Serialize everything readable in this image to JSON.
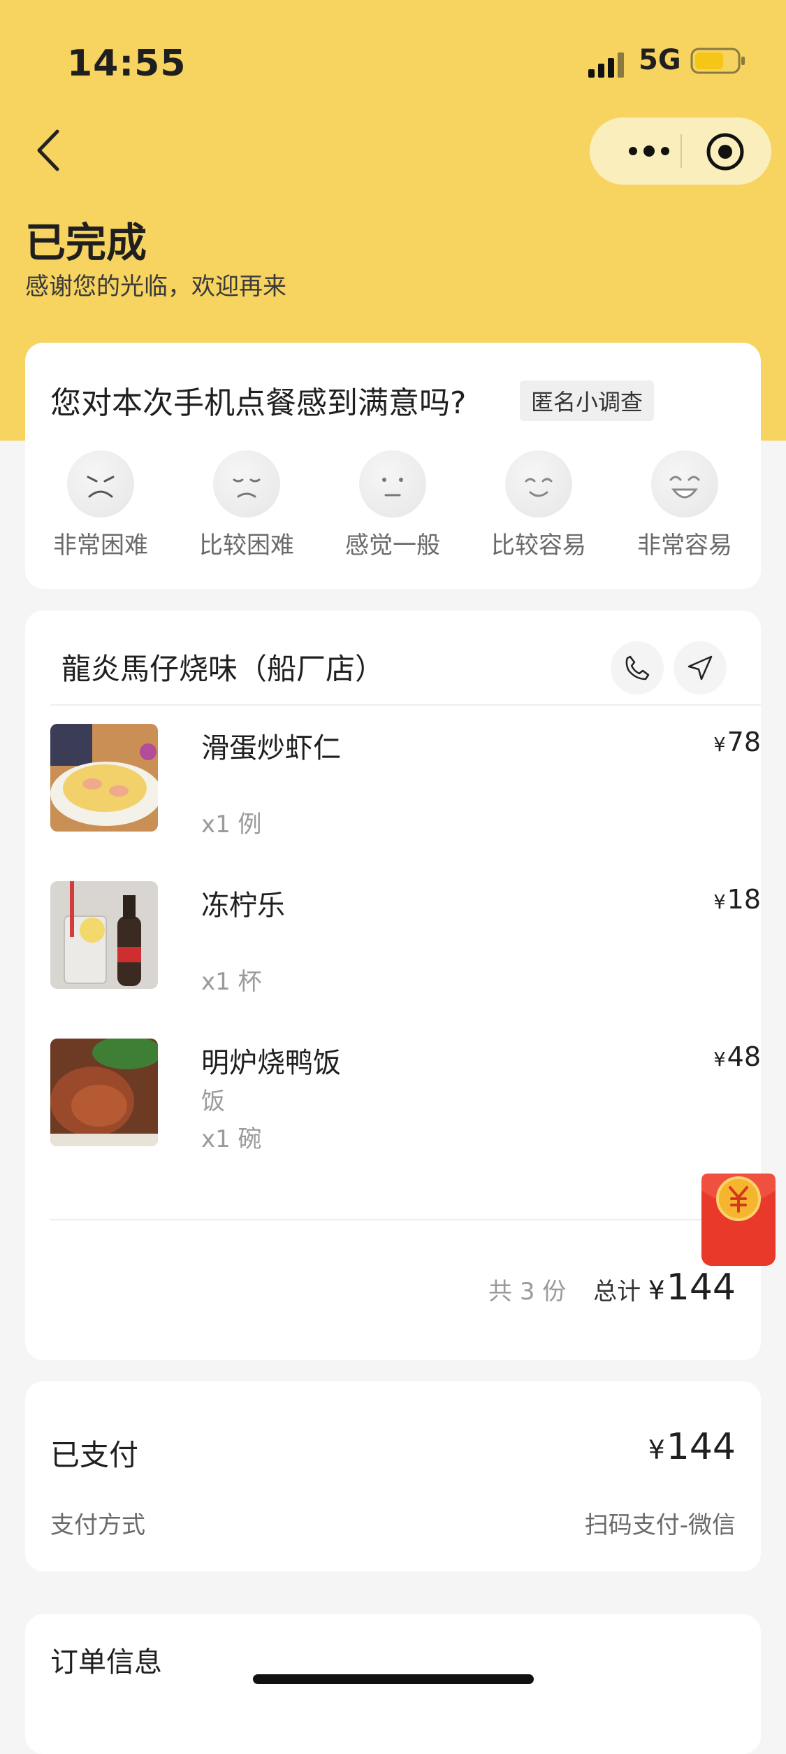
{
  "status_bar": {
    "time": "14:55",
    "network": "5G"
  },
  "header": {
    "title": "已完成",
    "subtitle": "感谢您的光临，欢迎再来"
  },
  "survey": {
    "question": "您对本次手机点餐感到满意吗?",
    "tag": "匿名小调查",
    "options": [
      "非常困难",
      "比较困难",
      "感觉一般",
      "比较容易",
      "非常容易"
    ]
  },
  "order": {
    "store_name": "龍炎馬仔烧味（船厂店）",
    "items": [
      {
        "name": "滑蛋炒虾仁",
        "spec": "",
        "qty": "x1 例",
        "price": "78"
      },
      {
        "name": "冻柠乐",
        "spec": "",
        "qty": "x1 杯",
        "price": "18"
      },
      {
        "name": "明炉烧鸭饭",
        "spec": "饭",
        "qty": "x1 碗",
        "price": "48"
      }
    ],
    "count_text": "共 3 份",
    "total_label": "总计",
    "total_amount": "144",
    "currency": "¥"
  },
  "payment": {
    "status": "已支付",
    "amount": "144",
    "method_label": "支付方式",
    "method_value": "扫码支付-微信"
  },
  "info": {
    "title": "订单信息"
  },
  "colors": {
    "header": "#f7d35f",
    "capsule": "#fbeebd",
    "redpacket": "#e8392b"
  },
  "icons": [
    "back-icon",
    "more-icon",
    "target-icon",
    "phone-icon",
    "navigate-icon",
    "redpacket-icon"
  ]
}
